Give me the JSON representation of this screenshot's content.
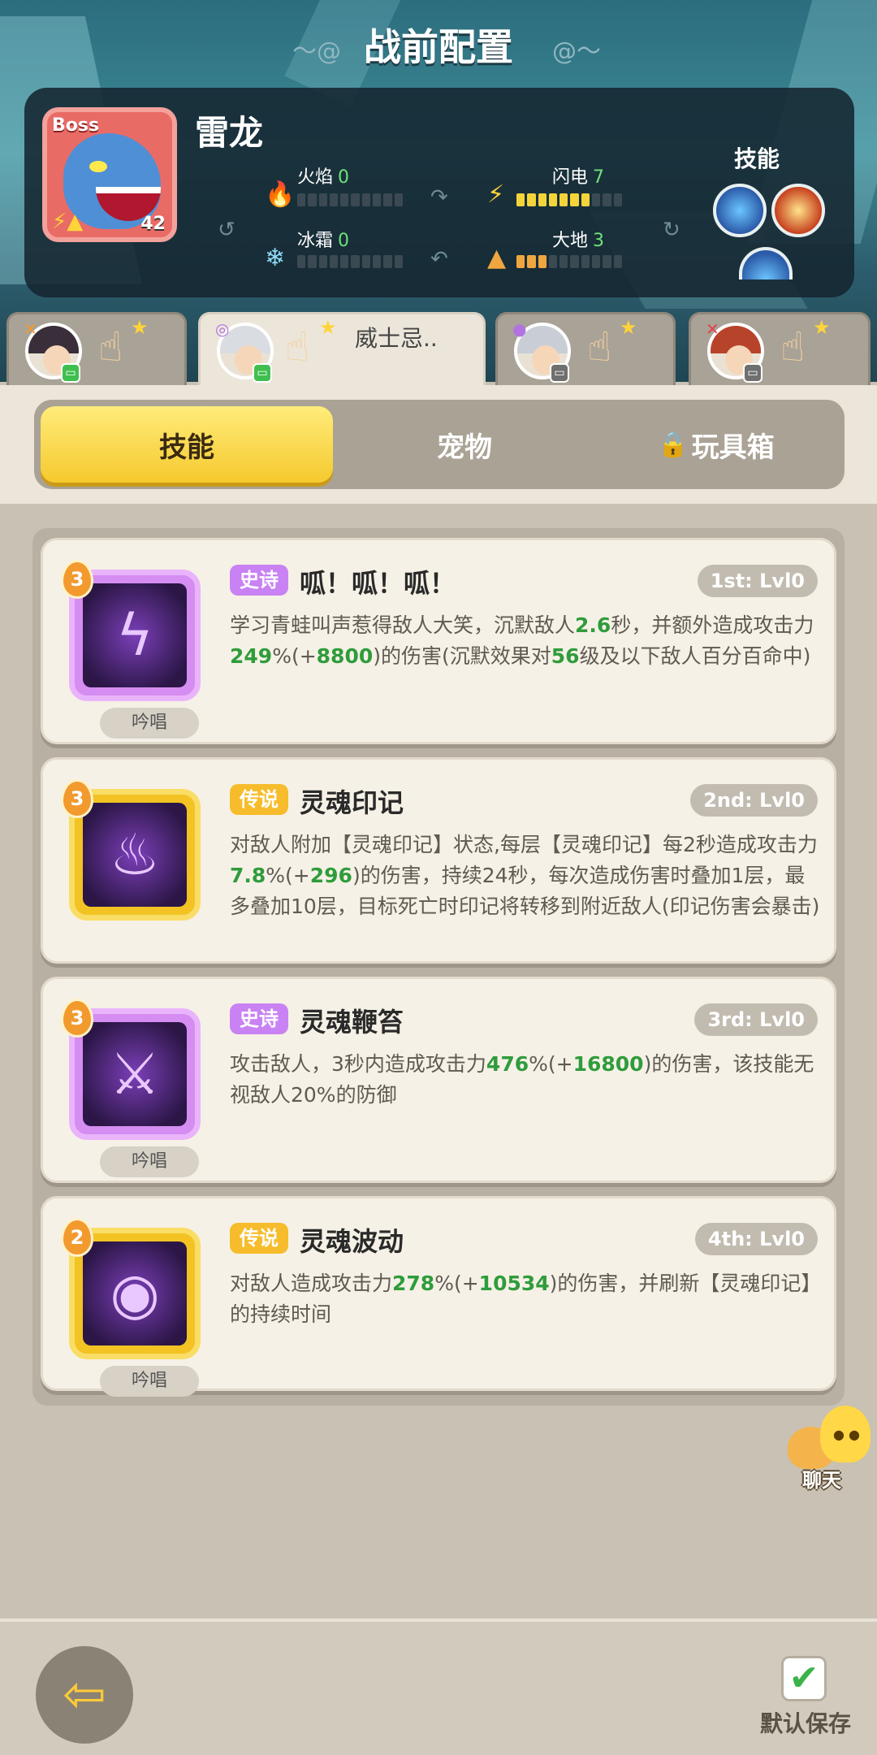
{
  "screen": {
    "title": "战前配置"
  },
  "boss": {
    "tag": "Boss",
    "name": "雷龙",
    "level": "42",
    "stats": {
      "fire": {
        "label": "火焰",
        "value": "0",
        "level": 0
      },
      "lightning": {
        "label": "闪电",
        "value": "7",
        "level": 7
      },
      "frost": {
        "label": "冰霜",
        "value": "0",
        "level": 0
      },
      "earth": {
        "label": "大地",
        "value": "3",
        "level": 3
      }
    },
    "skills_label": "技能"
  },
  "hero_tabs": [
    {
      "name": "",
      "active": false
    },
    {
      "name": "威士忌..",
      "active": true
    },
    {
      "name": "",
      "active": false
    },
    {
      "name": "",
      "active": false
    }
  ],
  "section_tabs": {
    "skills": "技能",
    "pets": "宠物",
    "toybox": "玩具箱"
  },
  "skills": [
    {
      "level": "3",
      "rarity": "史诗",
      "name": "呱！呱！呱！",
      "rank": "1st: Lvl0",
      "chant": "吟唱",
      "desc_parts": [
        "学习青蛙叫声惹得敌人大笑，沉默敌人",
        "2.6",
        "秒，并额外造成攻击力",
        "249",
        "%(+",
        "8800",
        ")的伤害(沉默效果对",
        "56",
        "级及以下敌人百分百命中)"
      ]
    },
    {
      "level": "3",
      "rarity": "传说",
      "name": "灵魂印记",
      "rank": "2nd: Lvl0",
      "desc_parts": [
        "对敌人附加【灵魂印记】状态,每层【灵魂印记】每2秒造成攻击力",
        "7.8",
        "%(+",
        "296",
        ")的伤害，持续24秒，每次造成伤害时叠加1层，最多叠加10层，目标死亡时印记将转移到附近敌人(印记伤害会暴击)"
      ]
    },
    {
      "level": "3",
      "rarity": "史诗",
      "name": "灵魂鞭笞",
      "rank": "3rd: Lvl0",
      "chant": "吟唱",
      "desc_parts": [
        "攻击敌人，3秒内造成攻击力",
        "476",
        "%(+",
        "16800",
        ")的伤害，该技能无视敌人20%的防御"
      ]
    },
    {
      "level": "2",
      "rarity": "传说",
      "name": "灵魂波动",
      "rank": "4th: Lvl0",
      "chant": "吟唱",
      "desc_parts": [
        "对敌人造成攻击力",
        "278",
        "%(+",
        "10534",
        ")的伤害，并刷新【灵魂印记】的持续时间"
      ]
    }
  ],
  "chat": {
    "label": "聊天"
  },
  "bottom": {
    "save_label": "默认保存"
  },
  "colors": {
    "accent_yellow": "#f5c92e",
    "epic": "#c982f3",
    "legend": "#f6bc2b",
    "green_value": "#2f9c3c"
  },
  "icons": {
    "back": "back-arrow-icon",
    "save": "checkbox-checked-icon",
    "lock": "lock-icon"
  }
}
